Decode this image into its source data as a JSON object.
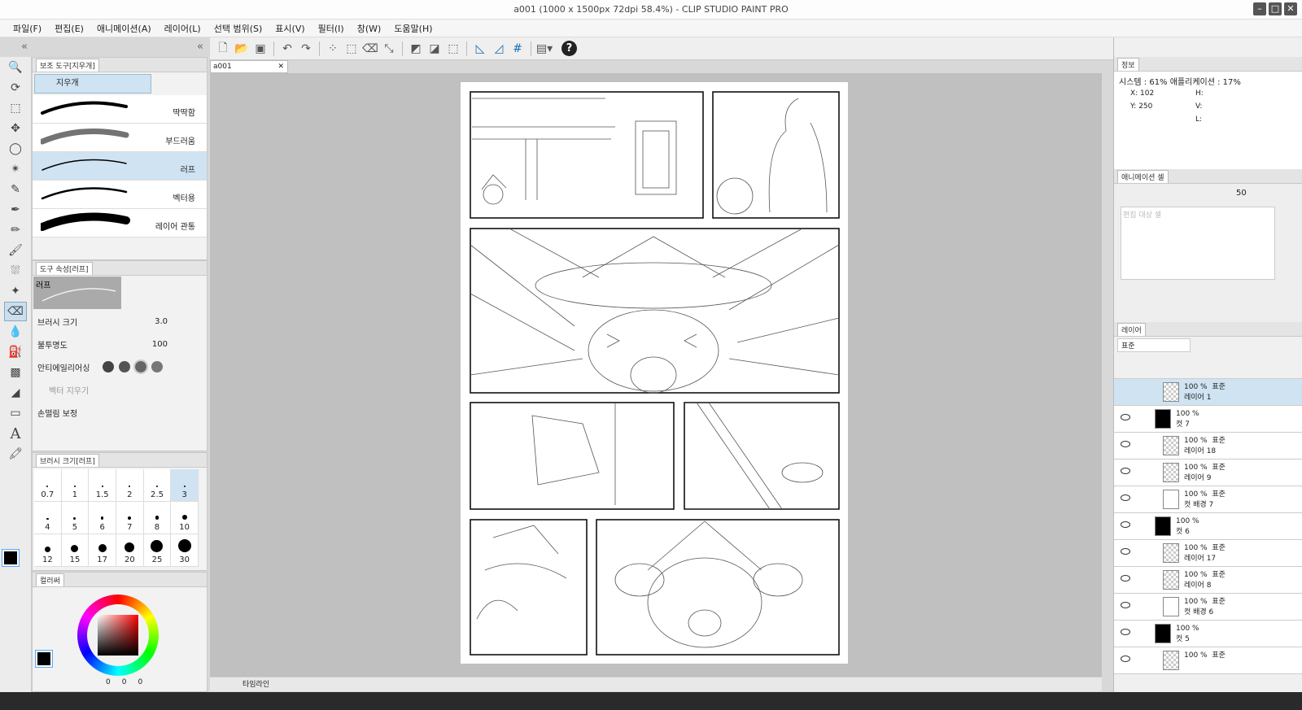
{
  "window": {
    "title": "a001 (1000 x 1500px 72dpi 58.4%)  - CLIP STUDIO PAINT PRO"
  },
  "menu": [
    "파일(F)",
    "편집(E)",
    "애니메이션(A)",
    "레이어(L)",
    "선택 범위(S)",
    "표시(V)",
    "필터(I)",
    "창(W)",
    "도움말(H)"
  ],
  "subtool": {
    "header": "보조 도구[지우개]",
    "group": "지우개",
    "brushes": [
      "딱딱함",
      "부드러움",
      "러프",
      "벡터용",
      "레이어 관통"
    ],
    "selected": "러프"
  },
  "tool_property": {
    "header": "도구 속성[러프]",
    "preview_label": "러프",
    "brush_size_label": "브러시 크기",
    "brush_size_value": "3.0",
    "opacity_label": "불투명도",
    "opacity_value": "100",
    "antialias_label": "안티에일리어싱",
    "vector_erase_label": "벡터 지우기",
    "stabilization_label": "손떨림 보정"
  },
  "brush_size_panel": {
    "header": "브러시 크기[러프]",
    "sizes": [
      "0.7",
      "1",
      "1.5",
      "2",
      "2.5",
      "3",
      "4",
      "5",
      "6",
      "7",
      "8",
      "10",
      "12",
      "15",
      "17",
      "20",
      "25",
      "30"
    ],
    "selected": "3"
  },
  "color_panel": {
    "header": "컬러써",
    "h": "0",
    "s": "0",
    "v": "0"
  },
  "document_tab": "a001",
  "timeline_label": "타임라인",
  "info_panel": {
    "tab": "정보",
    "memory": "시스템 : 61%   애플리케이션 : 17%",
    "x": "X: 102",
    "y": "Y: 250",
    "h": "H:",
    "v": "V:",
    "l": "L:"
  },
  "animation_panel": {
    "tab": "애니메이션 셀",
    "opacity": "50",
    "placeholder": "편집 대상 셀"
  },
  "layer_panel": {
    "tab": "레이어",
    "blend": "표준",
    "layers": [
      {
        "pct": "100 %",
        "mode": "표준",
        "name": "레이어 1",
        "kind": "raster",
        "selected": true
      },
      {
        "pct": "100 %",
        "mode": "",
        "name": "컷 7",
        "kind": "folder"
      },
      {
        "pct": "100 %",
        "mode": "표준",
        "name": "레이어 18",
        "kind": "raster"
      },
      {
        "pct": "100 %",
        "mode": "표준",
        "name": "레이어 9",
        "kind": "raster"
      },
      {
        "pct": "100 %",
        "mode": "표준",
        "name": "컷 배경 7",
        "kind": "bg"
      },
      {
        "pct": "100 %",
        "mode": "",
        "name": "컷 6",
        "kind": "folder"
      },
      {
        "pct": "100 %",
        "mode": "표준",
        "name": "레이어 17",
        "kind": "raster"
      },
      {
        "pct": "100 %",
        "mode": "표준",
        "name": "레이어 8",
        "kind": "raster"
      },
      {
        "pct": "100 %",
        "mode": "표준",
        "name": "컷 배경 6",
        "kind": "bg"
      },
      {
        "pct": "100 %",
        "mode": "",
        "name": "컷 5",
        "kind": "folder"
      },
      {
        "pct": "100 %",
        "mode": "표준",
        "name": "",
        "kind": "raster"
      }
    ]
  },
  "colors": {
    "accent": "#cfe3f2",
    "main_color": "#000000",
    "sub_color": "#3a200e"
  }
}
